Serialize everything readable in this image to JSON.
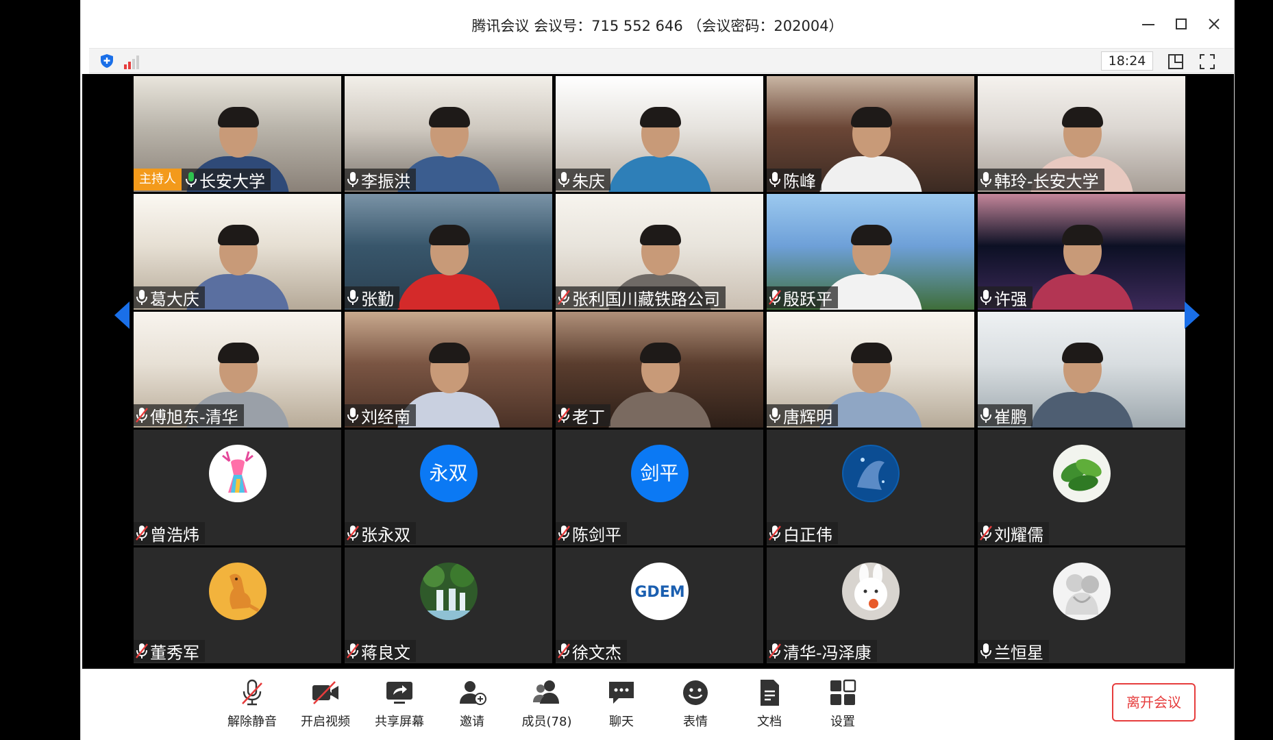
{
  "window": {
    "title": "腾讯会议 会议号：715 552 646 （会议密码：202004）"
  },
  "infobar": {
    "time": "18:24"
  },
  "host_badge": "主持人",
  "participants": [
    {
      "name": "长安大学",
      "mic": "on",
      "type": "video",
      "host": true
    },
    {
      "name": "李振洪",
      "mic": "on",
      "type": "video"
    },
    {
      "name": "朱庆",
      "mic": "on",
      "type": "video"
    },
    {
      "name": "陈峰",
      "mic": "on",
      "type": "video"
    },
    {
      "name": "韩玲-长安大学",
      "mic": "on",
      "type": "video"
    },
    {
      "name": "葛大庆",
      "mic": "on",
      "type": "video"
    },
    {
      "name": "张勤",
      "mic": "on",
      "type": "video"
    },
    {
      "name": "张利国川藏铁路公司",
      "mic": "muted",
      "type": "video"
    },
    {
      "name": "殷跃平",
      "mic": "muted",
      "type": "video"
    },
    {
      "name": "许强",
      "mic": "on",
      "type": "video"
    },
    {
      "name": "傅旭东-清华",
      "mic": "muted",
      "type": "video"
    },
    {
      "name": "刘经南",
      "mic": "on",
      "type": "video"
    },
    {
      "name": "老丁",
      "mic": "muted",
      "type": "video"
    },
    {
      "name": "唐辉明",
      "mic": "on",
      "type": "video"
    },
    {
      "name": "崔鹏",
      "mic": "on",
      "type": "video"
    },
    {
      "name": "曾浩炜",
      "mic": "muted",
      "type": "avatar",
      "avatar": "deer-avatar"
    },
    {
      "name": "张永双",
      "mic": "muted",
      "type": "avatar-text",
      "avatar_text": "永双"
    },
    {
      "name": "陈剑平",
      "mic": "muted",
      "type": "avatar-text",
      "avatar_text": "剑平"
    },
    {
      "name": "白正伟",
      "mic": "muted",
      "type": "avatar",
      "avatar": "ocean-avatar"
    },
    {
      "name": "刘耀儒",
      "mic": "muted",
      "type": "avatar",
      "avatar": "leaf-avatar"
    },
    {
      "name": "董秀军",
      "mic": "muted",
      "type": "avatar",
      "avatar": "kangaroo-avatar"
    },
    {
      "name": "蒋良文",
      "mic": "muted",
      "type": "avatar",
      "avatar": "waterfall-avatar"
    },
    {
      "name": "徐文杰",
      "mic": "muted",
      "type": "avatar",
      "avatar": "logo-avatar",
      "avatar_text": "GDEM"
    },
    {
      "name": "清华-冯泽康",
      "mic": "muted",
      "type": "avatar",
      "avatar": "bunny-avatar"
    },
    {
      "name": "兰恒星",
      "mic": "on",
      "type": "avatar",
      "avatar": "statue-avatar"
    }
  ],
  "toolbar": {
    "unmute": "解除静音",
    "start_video": "开启视频",
    "share_screen": "共享屏幕",
    "invite": "邀请",
    "members": "成员(78)",
    "chat": "聊天",
    "reactions": "表情",
    "docs": "文档",
    "settings": "设置",
    "leave": "离开会议"
  },
  "colors": {
    "accent_blue": "#0b79f4",
    "leave_red": "#e63c3c",
    "host_orange": "#f39a1b",
    "mic_green": "#2ec24f",
    "muted_red": "#e63c3c"
  }
}
